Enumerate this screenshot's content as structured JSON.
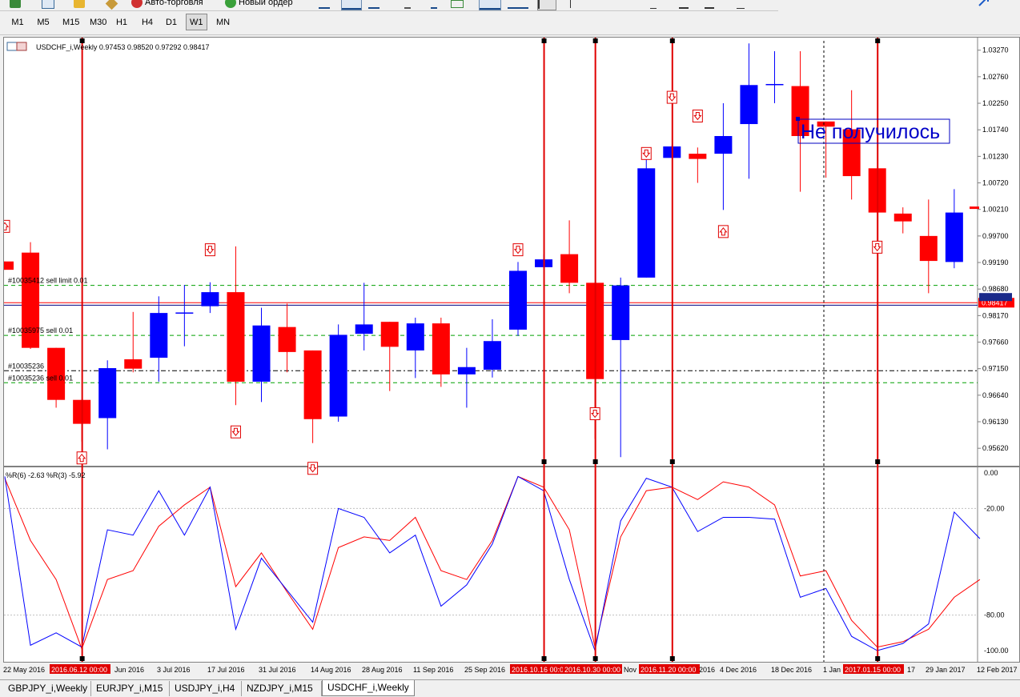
{
  "toolbar": {
    "auto_trading_label": "Авто-торговля",
    "new_order_label": "Новый ордер"
  },
  "timeframes": [
    "M1",
    "M5",
    "M15",
    "M30",
    "H1",
    "H4",
    "D1",
    "W1",
    "MN"
  ],
  "active_timeframe": "W1",
  "chart": {
    "header": "USDCHF_i,Weekly  0.97453 0.98520 0.97292 0.98417",
    "current_price": "0.98417",
    "annotation": "Не получилось",
    "bull_color": "#0000ff",
    "bear_color": "#ff0000",
    "price_axis": {
      "min": 0.953,
      "max": 1.0345,
      "labels": [
        "1.03270",
        "1.02760",
        "1.02250",
        "1.01740",
        "1.01230",
        "1.00720",
        "1.00210",
        "0.99700",
        "0.99190",
        "0.98680",
        "0.98170",
        "0.97660",
        "0.97150",
        "0.96640",
        "0.96130",
        "0.95620"
      ]
    },
    "order_lines": [
      {
        "label": "#10035412 sell limit 0.01",
        "price": 0.9875,
        "color": "#00a000",
        "style": "dashed"
      },
      {
        "label": "#10035975 sell 0.01",
        "price": 0.9779,
        "color": "#00a000",
        "style": "dashed"
      },
      {
        "label": "#10035236",
        "price": 0.9711,
        "color": "#000000",
        "style": "dashdot"
      },
      {
        "label": "#10035236 sell 0.01",
        "price": 0.9688,
        "color": "#00a000",
        "style": "dashed"
      }
    ],
    "bid_line": 0.98417,
    "bid_line_2": 0.9837,
    "time_labels": [
      "22 May 2016",
      "Jun 2016",
      "3 Jul 2016",
      "17 Jul 2016",
      "31 Jul 2016",
      "14 Aug 2016",
      "28 Aug 2016",
      "11 Sep 2016",
      "25 Sep 2016",
      "Nov",
      "2016",
      "4 Dec 2016",
      "18 Dec 2016",
      "1 Jan",
      "17",
      "29 Jan 2017",
      "12 Feb 2017"
    ],
    "time_markers": [
      "2016.06.12 00:00",
      "2016.10.16 00:00",
      "2016.10.30 00:00",
      "2016.11.20 00:00",
      "2017.01.15 00:00"
    ]
  },
  "indicator": {
    "label": "%R(6) -2.63 %R(3) -5.92",
    "levels": [
      "0.00",
      "-20.00",
      "-80.00",
      "-100.00"
    ],
    "series": [
      {
        "name": "%R(6)",
        "color": "#ff0000",
        "values": [
          -3,
          -38,
          -60,
          -99,
          -60,
          -55,
          -30,
          -18,
          -8,
          -64,
          -45,
          -67,
          -88,
          -42,
          -36,
          -38,
          -25,
          -55,
          -60,
          -38,
          -2,
          -8,
          -32,
          -98,
          -36,
          -10,
          -8,
          -15,
          -5,
          -8,
          -18,
          -58,
          -55,
          -83,
          -98,
          -95,
          -88,
          -70,
          -60
        ]
      },
      {
        "name": "%R(3)",
        "color": "#0000ff",
        "values": [
          -2,
          -97,
          -90,
          -98,
          -32,
          -35,
          -10,
          -35,
          -8,
          -88,
          -48,
          -66,
          -84,
          -20,
          -25,
          -45,
          -35,
          -75,
          -63,
          -40,
          -2,
          -10,
          -60,
          -100,
          -27,
          -3,
          -8,
          -33,
          -25,
          -25,
          -26,
          -70,
          -65,
          -92,
          -100,
          -96,
          -85,
          -22,
          -37
        ]
      }
    ]
  },
  "candles": [
    {
      "o": 0.9921,
      "h": 0.9921,
      "l": 0.9905,
      "c": 0.9905
    },
    {
      "o": 0.9938,
      "h": 0.9958,
      "l": 0.9753,
      "c": 0.9755
    },
    {
      "o": 0.9755,
      "h": 0.9755,
      "l": 0.964,
      "c": 0.9655
    },
    {
      "o": 0.9655,
      "h": 0.9655,
      "l": 0.9575,
      "c": 0.9609
    },
    {
      "o": 0.962,
      "h": 0.9731,
      "l": 0.956,
      "c": 0.9716
    },
    {
      "o": 0.9733,
      "h": 0.9824,
      "l": 0.9708,
      "c": 0.9715
    },
    {
      "o": 0.9736,
      "h": 0.9854,
      "l": 0.969,
      "c": 0.9822
    },
    {
      "o": 0.9822,
      "h": 0.9876,
      "l": 0.9758,
      "c": 0.9823
    },
    {
      "o": 0.9835,
      "h": 0.9881,
      "l": 0.9822,
      "c": 0.9862
    },
    {
      "o": 0.9862,
      "h": 0.995,
      "l": 0.9645,
      "c": 0.969
    },
    {
      "o": 0.969,
      "h": 0.9832,
      "l": 0.9651,
      "c": 0.9798
    },
    {
      "o": 0.9795,
      "h": 0.984,
      "l": 0.9708,
      "c": 0.9747
    },
    {
      "o": 0.975,
      "h": 0.975,
      "l": 0.9572,
      "c": 0.9618
    },
    {
      "o": 0.9623,
      "h": 0.98,
      "l": 0.9613,
      "c": 0.978
    },
    {
      "o": 0.9782,
      "h": 0.988,
      "l": 0.975,
      "c": 0.98
    },
    {
      "o": 0.9805,
      "h": 0.9805,
      "l": 0.9672,
      "c": 0.9757
    },
    {
      "o": 0.975,
      "h": 0.9813,
      "l": 0.9697,
      "c": 0.9802
    },
    {
      "o": 0.9802,
      "h": 0.9813,
      "l": 0.968,
      "c": 0.9704
    },
    {
      "o": 0.9704,
      "h": 0.9755,
      "l": 0.964,
      "c": 0.9718
    },
    {
      "o": 0.9713,
      "h": 0.981,
      "l": 0.9698,
      "c": 0.9768
    },
    {
      "o": 0.979,
      "h": 0.992,
      "l": 0.9778,
      "c": 0.9903
    },
    {
      "o": 0.991,
      "h": 0.9935,
      "l": 0.991,
      "c": 0.9925
    },
    {
      "o": 0.9935,
      "h": 1.0,
      "l": 0.986,
      "c": 0.988
    },
    {
      "o": 0.988,
      "h": 0.988,
      "l": 0.958,
      "c": 0.9695
    },
    {
      "o": 0.977,
      "h": 0.989,
      "l": 0.9545,
      "c": 0.9875
    },
    {
      "o": 0.989,
      "h": 1.0125,
      "l": 0.989,
      "c": 1.01
    },
    {
      "o": 1.012,
      "h": 1.0145,
      "l": 1.012,
      "c": 1.0142
    },
    {
      "o": 1.0128,
      "h": 1.014,
      "l": 1.0072,
      "c": 1.0118
    },
    {
      "o": 1.0128,
      "h": 1.0225,
      "l": 1.002,
      "c": 1.0162
    },
    {
      "o": 1.0185,
      "h": 1.034,
      "l": 1.008,
      "c": 1.026
    },
    {
      "o": 1.0262,
      "h": 1.0325,
      "l": 1.0225,
      "c": 1.0262
    },
    {
      "o": 1.0258,
      "h": 1.0325,
      "l": 1.0055,
      "c": 1.0162
    },
    {
      "o": 1.019,
      "h": 1.019,
      "l": 1.0082,
      "c": 1.018
    },
    {
      "o": 1.0175,
      "h": 1.025,
      "l": 1.004,
      "c": 1.0085
    },
    {
      "o": 1.01,
      "h": 1.01,
      "l": 0.996,
      "c": 1.0015
    },
    {
      "o": 1.0013,
      "h": 1.0025,
      "l": 0.9975,
      "c": 0.9998
    },
    {
      "o": 0.997,
      "h": 1.004,
      "l": 0.986,
      "c": 0.9922
    },
    {
      "o": 0.992,
      "h": 1.006,
      "l": 0.9908,
      "c": 1.0015
    }
  ]
}
